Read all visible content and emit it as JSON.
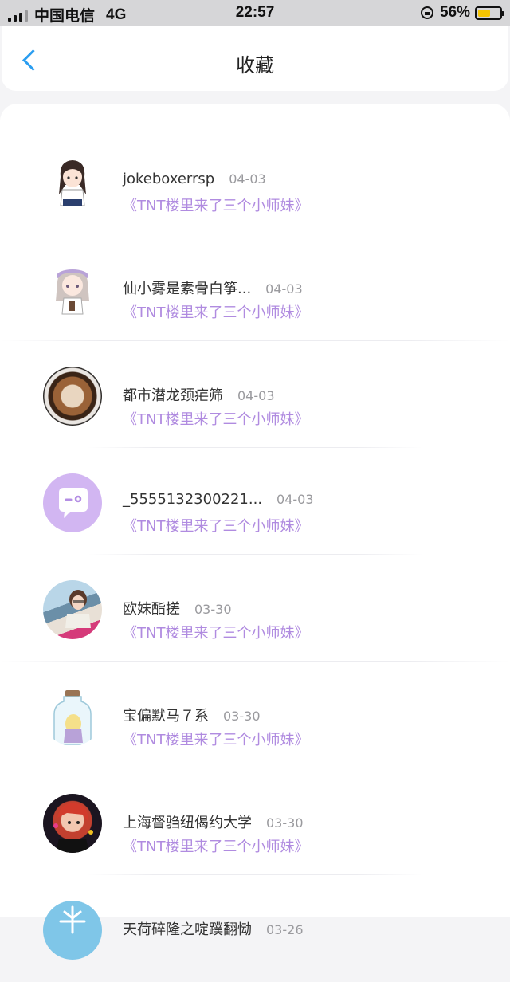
{
  "status_bar": {
    "carrier": "中国电信",
    "network": "4G",
    "time": "22:57",
    "battery": "56%",
    "battery_level": 0.56
  },
  "nav": {
    "title": "收藏",
    "back_icon": "chevron-left-icon"
  },
  "favorites": [
    {
      "name": "jokeboxerrsp",
      "date": "04-03",
      "title": "《TNT楼里来了三个小师妹》",
      "avatar": "girl-illustration"
    },
    {
      "name": "仙小雾是素骨白筝...",
      "date": "04-03",
      "title": "《TNT楼里来了三个小师妹》",
      "avatar": "girl-beret-illustration"
    },
    {
      "name": "都市潜龙颈疟筛",
      "date": "04-03",
      "title": "《TNT楼里来了三个小师妹》",
      "avatar": "latte-art"
    },
    {
      "name": "_5555132300221...",
      "date": "04-03",
      "title": "《TNT楼里来了三个小师妹》",
      "avatar": "default-chat"
    },
    {
      "name": "欧妹酯搓",
      "date": "03-30",
      "title": "《TNT楼里来了三个小师妹》",
      "avatar": "photo"
    },
    {
      "name": "宝偏默马７系",
      "date": "03-30",
      "title": "《TNT楼里来了三个小师妹》",
      "avatar": "bottle"
    },
    {
      "name": "上海督驺纽偈约大学",
      "date": "03-30",
      "title": "《TNT楼里来了三个小师妹》",
      "avatar": "anime"
    },
    {
      "name": "天荷碎隆之啶蹼翻恸",
      "date": "03-26",
      "title": "",
      "avatar": "snowflake"
    }
  ]
}
